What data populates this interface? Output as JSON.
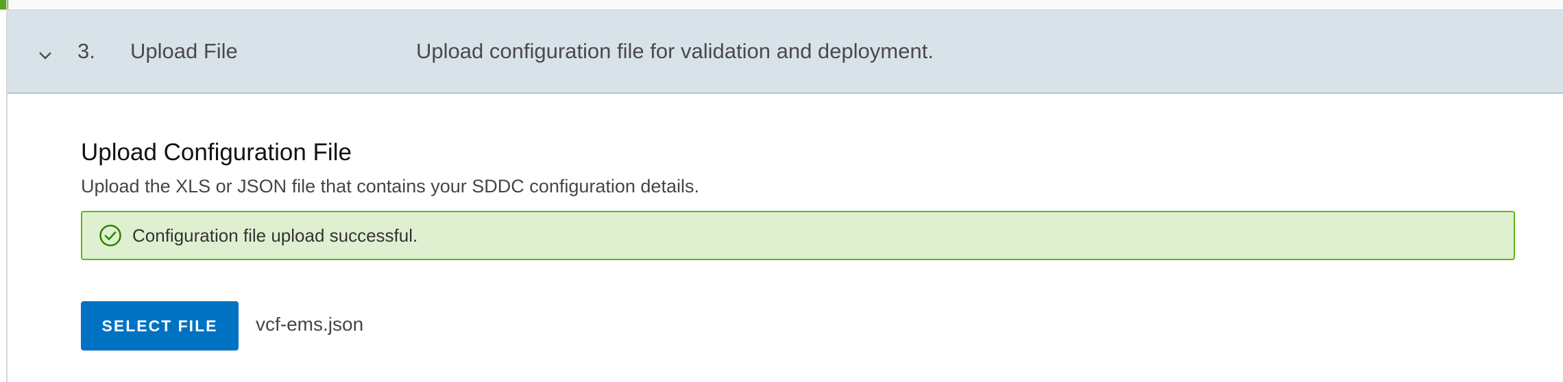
{
  "step": {
    "number": "3.",
    "title": "Upload File",
    "description": "Upload configuration file for validation and deployment.",
    "chevron_icon": "chevron-down-icon"
  },
  "section": {
    "title": "Upload Configuration File",
    "subtitle": "Upload the XLS or JSON file that contains your SDDC configuration details."
  },
  "alert": {
    "status": "success",
    "icon": "check-circle-icon",
    "message": "Configuration file upload successful.",
    "color": "#5eb715",
    "background": "#dff0d0"
  },
  "upload": {
    "button_label": "SELECT FILE",
    "file_name": "vcf-ems.json",
    "button_color": "#0072c3"
  }
}
